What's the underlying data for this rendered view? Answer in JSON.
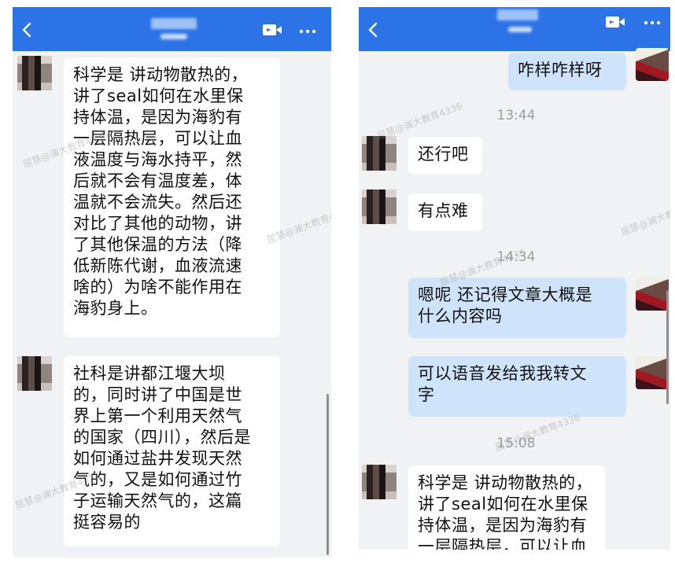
{
  "left_chat": {
    "messages": [
      {
        "side": "in",
        "text": "科学是 讲动物散热的，\n讲了seal如何在水里保\n持体温，是因为海豹有\n一层隔热层，可以让血\n液温度与海水持平，然\n后就不会有温度差，体\n温就不会流失。然后还\n对比了其他的动物，讲\n了其他保温的方法（降\n低新陈代谢，血液流速\n啥的）为啥不能作用在\n海豹身上。"
      },
      {
        "side": "in",
        "text": "社科是讲都江堰大坝\n的，同时讲了中国是世\n界上第一个利用天然气\n的国家（四川），然后是\n如何通过盐井发现天然\n气的，又是如何通过竹\n子运输天然气的，这篇\n挺容易的"
      }
    ]
  },
  "right_chat": {
    "messages": [
      {
        "side": "out",
        "text": "咋样咋样呀"
      },
      {
        "time": "13:44"
      },
      {
        "side": "in",
        "text": "还行吧"
      },
      {
        "side": "in",
        "text": "有点难"
      },
      {
        "time": "14:34"
      },
      {
        "side": "out",
        "text": "嗯呢 还记得文章大概是\n什么内容吗"
      },
      {
        "side": "out",
        "text": "可以语音发给我我转文\n字"
      },
      {
        "time": "15:08"
      },
      {
        "side": "in",
        "text": "科学是 讲动物散热的，\n讲了seal如何在水里保\n持体温，是因为海豹有\n一层隔热层，可以让血"
      }
    ]
  },
  "watermark": "屈慧@澜大教育4336",
  "colors": {
    "header": "#2d73e8",
    "incoming_bubble": "#ffffff",
    "outgoing_bubble": "#cfe4fa",
    "background": "#f1f2f4"
  },
  "icons": [
    "back-icon",
    "video-call-icon",
    "more-icon"
  ]
}
